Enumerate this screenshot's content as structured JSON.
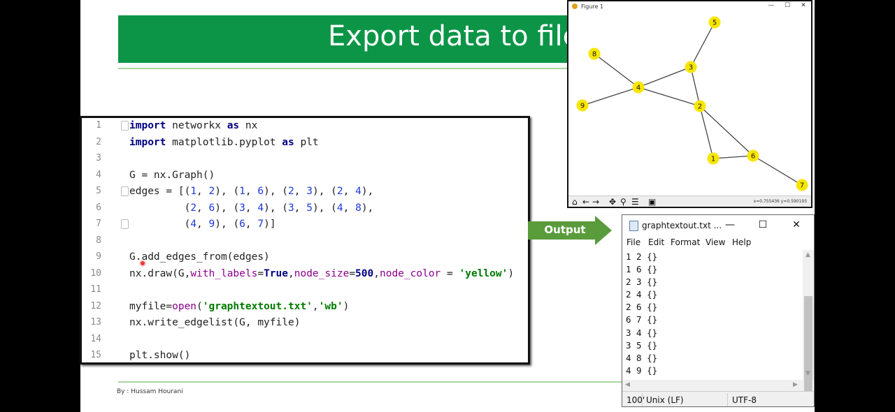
{
  "slide": {
    "title": "Export data to file",
    "footer": "By : Hussam Hourani"
  },
  "editor": {
    "lines": [
      {
        "n": "1",
        "tokens": [
          {
            "t": "import",
            "c": "kw"
          },
          {
            "t": " networkx "
          },
          {
            "t": "as",
            "c": "kw"
          },
          {
            "t": " nx"
          }
        ],
        "fold": true
      },
      {
        "n": "2",
        "tokens": [
          {
            "t": "import",
            "c": "kw"
          },
          {
            "t": " matplotlib.pyplot "
          },
          {
            "t": "as",
            "c": "kw"
          },
          {
            "t": " plt"
          }
        ]
      },
      {
        "n": "3",
        "tokens": []
      },
      {
        "n": "4",
        "tokens": [
          {
            "t": "G = nx.Graph()"
          }
        ]
      },
      {
        "n": "5",
        "tokens": [
          {
            "t": "edges = [("
          },
          {
            "t": "1",
            "c": "num"
          },
          {
            "t": ", "
          },
          {
            "t": "2",
            "c": "num"
          },
          {
            "t": "), ("
          },
          {
            "t": "1",
            "c": "num"
          },
          {
            "t": ", "
          },
          {
            "t": "6",
            "c": "num"
          },
          {
            "t": "), ("
          },
          {
            "t": "2",
            "c": "num"
          },
          {
            "t": ", "
          },
          {
            "t": "3",
            "c": "num"
          },
          {
            "t": "), ("
          },
          {
            "t": "2",
            "c": "num"
          },
          {
            "t": ", "
          },
          {
            "t": "4",
            "c": "num"
          },
          {
            "t": "),"
          }
        ],
        "fold": true
      },
      {
        "n": "6",
        "tokens": [
          {
            "t": "         ("
          },
          {
            "t": "2",
            "c": "num"
          },
          {
            "t": ", "
          },
          {
            "t": "6",
            "c": "num"
          },
          {
            "t": "), ("
          },
          {
            "t": "3",
            "c": "num"
          },
          {
            "t": ", "
          },
          {
            "t": "4",
            "c": "num"
          },
          {
            "t": "), ("
          },
          {
            "t": "3",
            "c": "num"
          },
          {
            "t": ", "
          },
          {
            "t": "5",
            "c": "num"
          },
          {
            "t": "), ("
          },
          {
            "t": "4",
            "c": "num"
          },
          {
            "t": ", "
          },
          {
            "t": "8",
            "c": "num"
          },
          {
            "t": "),"
          }
        ]
      },
      {
        "n": "7",
        "tokens": [
          {
            "t": "         ("
          },
          {
            "t": "4",
            "c": "num"
          },
          {
            "t": ", "
          },
          {
            "t": "9",
            "c": "num"
          },
          {
            "t": "), ("
          },
          {
            "t": "6",
            "c": "num"
          },
          {
            "t": ", "
          },
          {
            "t": "7",
            "c": "num"
          },
          {
            "t": ")]"
          }
        ],
        "fold": true
      },
      {
        "n": "8",
        "tokens": []
      },
      {
        "n": "9",
        "tokens": [
          {
            "t": "G.add_edges_from(edges)"
          }
        ]
      },
      {
        "n": "10",
        "tokens": [
          {
            "t": "nx.draw(G,"
          },
          {
            "t": "with_labels",
            "c": "kwarg"
          },
          {
            "t": "="
          },
          {
            "t": "True",
            "c": "kw"
          },
          {
            "t": ","
          },
          {
            "t": "node_size",
            "c": "kwarg"
          },
          {
            "t": "="
          },
          {
            "t": "500",
            "c": "kw"
          },
          {
            "t": ","
          },
          {
            "t": "node_color",
            "c": "kwarg"
          },
          {
            "t": " = "
          },
          {
            "t": "'yellow'",
            "c": "str"
          },
          {
            "t": ")"
          }
        ]
      },
      {
        "n": "11",
        "tokens": []
      },
      {
        "n": "12",
        "tokens": [
          {
            "t": "myfile="
          },
          {
            "t": "open",
            "c": "kwarg"
          },
          {
            "t": "("
          },
          {
            "t": "'graphtextout.txt'",
            "c": "str"
          },
          {
            "t": ","
          },
          {
            "t": "'wb'",
            "c": "str"
          },
          {
            "t": ")"
          }
        ]
      },
      {
        "n": "13",
        "tokens": [
          {
            "t": "nx.write_edgelist(G, myfile)"
          }
        ]
      },
      {
        "n": "14",
        "tokens": []
      },
      {
        "n": "15",
        "tokens": [
          {
            "t": "plt.show()"
          }
        ]
      }
    ]
  },
  "output_arrow": {
    "label": "Output",
    "color": "#5a9b3c"
  },
  "figure": {
    "title": "Figure 1",
    "coords": "x=0.755436     y=0.590193",
    "nodes": [
      "5",
      "8",
      "3",
      "4",
      "9",
      "2",
      "6",
      "1",
      "7"
    ],
    "node_color": "#f7e600"
  },
  "notepad": {
    "title": "graphtextout.txt ...",
    "menu": [
      "File",
      "Edit",
      "Format",
      "View",
      "Help"
    ],
    "lines": [
      "1 2 {}",
      "1 6 {}",
      "2 3 {}",
      "2 4 {}",
      "2 6 {}",
      "6 7 {}",
      "3 4 {}",
      "3 5 {}",
      "4 8 {}",
      "4 9 {}"
    ],
    "status": {
      "zoom": "100'",
      "eol": "Unix (LF)",
      "encoding": "UTF-8"
    }
  }
}
